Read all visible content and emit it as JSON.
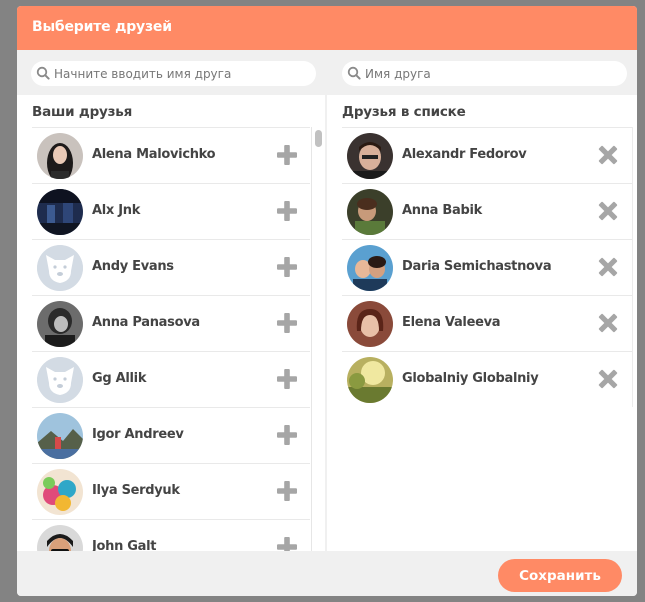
{
  "modal": {
    "title": "Выберите друзей",
    "save_label": "Сохранить"
  },
  "search_left": {
    "placeholder": "Начните вводить имя друга",
    "value": "",
    "icon": "search-icon"
  },
  "search_right": {
    "placeholder": "Имя друга",
    "value": "",
    "icon": "search-icon"
  },
  "left": {
    "heading": "Ваши друзья",
    "action_icon": "plus-icon",
    "items": [
      {
        "name": "Alena Malovichko",
        "avatar": "photo"
      },
      {
        "name": "Alx Jnk",
        "avatar": "photo"
      },
      {
        "name": "Andy Evans",
        "avatar": "default-dog"
      },
      {
        "name": "Anna Panasova",
        "avatar": "photo"
      },
      {
        "name": "Gg Allik",
        "avatar": "default-dog"
      },
      {
        "name": "Igor Andreev",
        "avatar": "photo"
      },
      {
        "name": "Ilya Serdyuk",
        "avatar": "photo"
      },
      {
        "name": "John Galt",
        "avatar": "photo"
      }
    ]
  },
  "right": {
    "heading": "Друзья в списке",
    "action_icon": "remove-icon",
    "items": [
      {
        "name": "Alexandr Fedorov",
        "avatar": "photo"
      },
      {
        "name": "Anna Babik",
        "avatar": "photo"
      },
      {
        "name": "Daria Semichastnova",
        "avatar": "photo"
      },
      {
        "name": "Elena Valeeva",
        "avatar": "photo"
      },
      {
        "name": "Globalniy Globalniy",
        "avatar": "photo"
      }
    ]
  },
  "colors": {
    "accent": "#ff8a65",
    "backdrop": "#838383",
    "panel": "#f0f0f0",
    "text": "#444444",
    "icon_gray": "#a6a6a6"
  }
}
